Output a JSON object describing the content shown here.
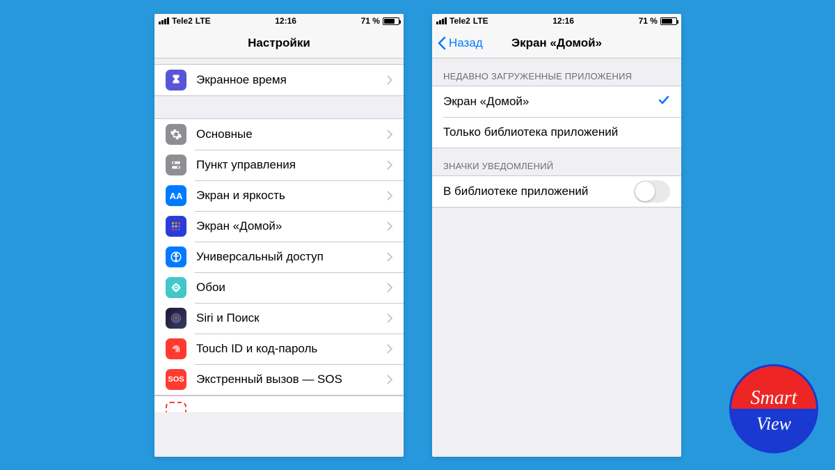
{
  "status": {
    "carrier": "Tele2",
    "network": "LTE",
    "time": "12:16",
    "battery_text": "71 %"
  },
  "left": {
    "title": "Настройки",
    "rows": {
      "screentime": "Экранное время",
      "general": "Основные",
      "control": "Пункт управления",
      "display": "Экран и яркость",
      "home": "Экран «Домой»",
      "access": "Универсальный доступ",
      "wallpaper": "Обои",
      "siri": "Siri и Поиск",
      "touchid": "Touch ID и код-пароль",
      "sos": "Экстренный вызов — SOS"
    }
  },
  "right": {
    "back": "Назад",
    "title": "Экран «Домой»",
    "section1": "НЕДАВНО ЗАГРУЖЕННЫЕ ПРИЛОЖЕНИЯ",
    "opt1": "Экран «Домой»",
    "opt2": "Только библиотека приложений",
    "section2": "ЗНАЧКИ УВЕДОМЛЕНИЙ",
    "toggleLabel": "В библиотеке приложений"
  },
  "logo": {
    "line1": "Smart",
    "line2": "View"
  }
}
